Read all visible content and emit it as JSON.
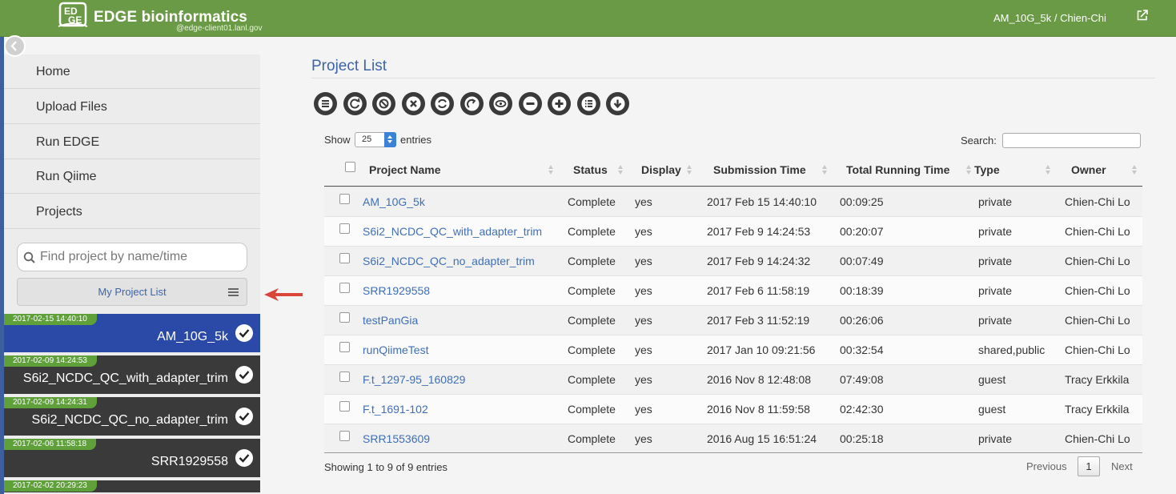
{
  "header": {
    "brand": "EDGE bioinformatics",
    "server": "@edge-client01.lanl.gov",
    "user": "AM_10G_5k / Chien-Chi",
    "accent": "#6a9a45"
  },
  "sidebar": {
    "nav": [
      "Home",
      "Upload Files",
      "Run EDGE",
      "Run Qiime",
      "Projects"
    ],
    "search_placeholder": "Find project by name/time",
    "list_button": "My Project List",
    "projects": [
      {
        "date": "2017-02-15 14:40:10",
        "name": "AM_10G_5k",
        "active": true
      },
      {
        "date": "2017-02-09 14:24:53",
        "name": "S6i2_NCDC_QC_with_adapter_trim",
        "active": false
      },
      {
        "date": "2017-02-09 14:24:31",
        "name": "S6i2_NCDC_QC_no_adapter_trim",
        "active": false
      },
      {
        "date": "2017-02-06 11:58:18",
        "name": "SRR1929558",
        "active": false
      },
      {
        "date": "2017-02-02 20:29:23",
        "name": "",
        "active": false
      }
    ]
  },
  "main": {
    "title": "Project List",
    "toolbar_icons": [
      "list-icon",
      "refresh-icon",
      "block-icon",
      "delete-icon",
      "sync-icon",
      "redo-icon",
      "view-icon",
      "remove-icon",
      "add-icon",
      "details-icon",
      "download-icon"
    ],
    "show_label": "Show",
    "page_length": "25",
    "entries_label": "entries",
    "search_label": "Search:",
    "columns": [
      "Project Name",
      "Status",
      "Display",
      "Submission Time",
      "Total Running Time",
      "Type",
      "Owner"
    ],
    "rows": [
      [
        "AM_10G_5k",
        "Complete",
        "yes",
        "2017 Feb 15 14:40:10",
        "00:09:25",
        "private",
        "Chien-Chi Lo"
      ],
      [
        "S6i2_NCDC_QC_with_adapter_trim",
        "Complete",
        "yes",
        "2017 Feb 9 14:24:53",
        "00:20:07",
        "private",
        "Chien-Chi Lo"
      ],
      [
        "S6i2_NCDC_QC_no_adapter_trim",
        "Complete",
        "yes",
        "2017 Feb 9 14:24:32",
        "00:07:49",
        "private",
        "Chien-Chi Lo"
      ],
      [
        "SRR1929558",
        "Complete",
        "yes",
        "2017 Feb 6 11:58:19",
        "00:18:39",
        "private",
        "Chien-Chi Lo"
      ],
      [
        "testPanGia",
        "Complete",
        "yes",
        "2017 Feb 3 11:52:19",
        "00:26:06",
        "private",
        "Chien-Chi Lo"
      ],
      [
        "runQiimeTest",
        "Complete",
        "yes",
        "2017 Jan 10 09:21:56",
        "00:32:54",
        "shared,public",
        "Chien-Chi Lo"
      ],
      [
        "F.t_1297-95_160829",
        "Complete",
        "yes",
        "2016 Nov 8 12:48:08",
        "07:49:08",
        "guest",
        "Tracy Erkkila"
      ],
      [
        "F.t_1691-102",
        "Complete",
        "yes",
        "2016 Nov 8 11:59:58",
        "02:42:30",
        "guest",
        "Tracy Erkkila"
      ],
      [
        "SRR1553609",
        "Complete",
        "yes",
        "2016 Aug 15 16:51:24",
        "00:25:18",
        "private",
        "Chien-Chi Lo"
      ]
    ],
    "info": "Showing 1 to 9 of 9 entries",
    "previous": "Previous",
    "page": "1",
    "next": "Next"
  }
}
